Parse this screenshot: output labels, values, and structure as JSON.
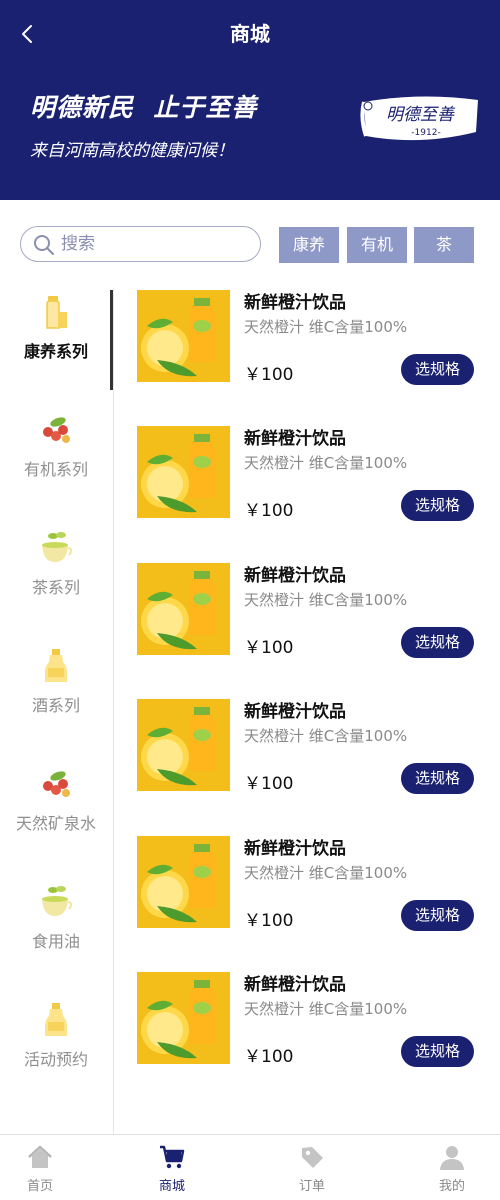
{
  "header": {
    "title": "商城",
    "slogan": "明德新民  止于至善",
    "subtitle": "来自河南高校的健康问候！",
    "seal_text": "明德至善",
    "seal_year": "-1912-",
    "bg_color": "#1b2171"
  },
  "search": {
    "placeholder": "搜索"
  },
  "tags": [
    "康养",
    "有机",
    "茶"
  ],
  "categories": [
    {
      "label": "康养系列",
      "icon": "juice-bottle-icon",
      "active": true
    },
    {
      "label": "有机系列",
      "icon": "berries-icon",
      "active": false
    },
    {
      "label": "茶系列",
      "icon": "tea-cup-icon",
      "active": false
    },
    {
      "label": "酒系列",
      "icon": "bottle-icon",
      "active": false
    },
    {
      "label": "天然矿泉水",
      "icon": "berries-icon",
      "active": false
    },
    {
      "label": "食用油",
      "icon": "tea-cup-icon",
      "active": false
    },
    {
      "label": "活动预约",
      "icon": "bottle-icon",
      "active": false
    }
  ],
  "products": [
    {
      "name": "新鲜橙汁饮品",
      "desc": "天然橙汁 维C含量100%",
      "price": "￥100",
      "button": "选规格"
    },
    {
      "name": "新鲜橙汁饮品",
      "desc": "天然橙汁 维C含量100%",
      "price": "￥100",
      "button": "选规格"
    },
    {
      "name": "新鲜橙汁饮品",
      "desc": "天然橙汁 维C含量100%",
      "price": "￥100",
      "button": "选规格"
    },
    {
      "name": "新鲜橙汁饮品",
      "desc": "天然橙汁 维C含量100%",
      "price": "￥100",
      "button": "选规格"
    },
    {
      "name": "新鲜橙汁饮品",
      "desc": "天然橙汁 维C含量100%",
      "price": "￥100",
      "button": "选规格"
    },
    {
      "name": "新鲜橙汁饮品",
      "desc": "天然橙汁 维C含量100%",
      "price": "￥100",
      "button": "选规格"
    }
  ],
  "tabbar": [
    {
      "label": "首页",
      "icon": "home-icon",
      "active": false
    },
    {
      "label": "商城",
      "icon": "cart-icon",
      "active": true
    },
    {
      "label": "订单",
      "icon": "tag-icon",
      "active": false
    },
    {
      "label": "我的",
      "icon": "user-icon",
      "active": false
    }
  ],
  "colors": {
    "primary": "#1b2171",
    "tag": "#8f99c7",
    "muted": "#8a8a8a"
  }
}
